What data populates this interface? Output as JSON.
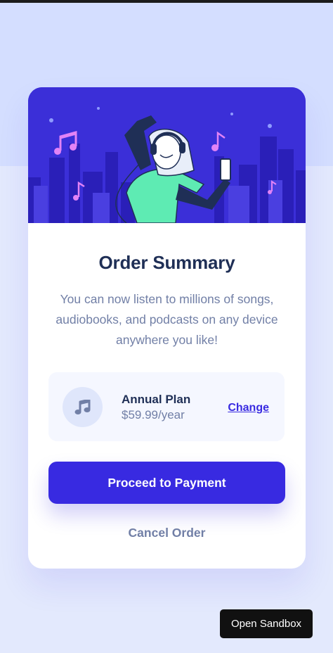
{
  "order": {
    "title": "Order Summary",
    "description": "You can now listen to millions of songs, audiobooks, and podcasts on any device anywhere you like!",
    "plan": {
      "icon": "music-note-icon",
      "name": "Annual Plan",
      "price": "$59.99/year",
      "change_label": "Change"
    },
    "proceed_label": "Proceed to Payment",
    "cancel_label": "Cancel Order"
  },
  "sandbox": {
    "label": "Open Sandbox"
  },
  "colors": {
    "accent": "#382AE1",
    "title": "#1F2F56",
    "muted": "#717FA6",
    "hero_background": "#3B2FD8",
    "page_background": "#E0E8FF"
  }
}
